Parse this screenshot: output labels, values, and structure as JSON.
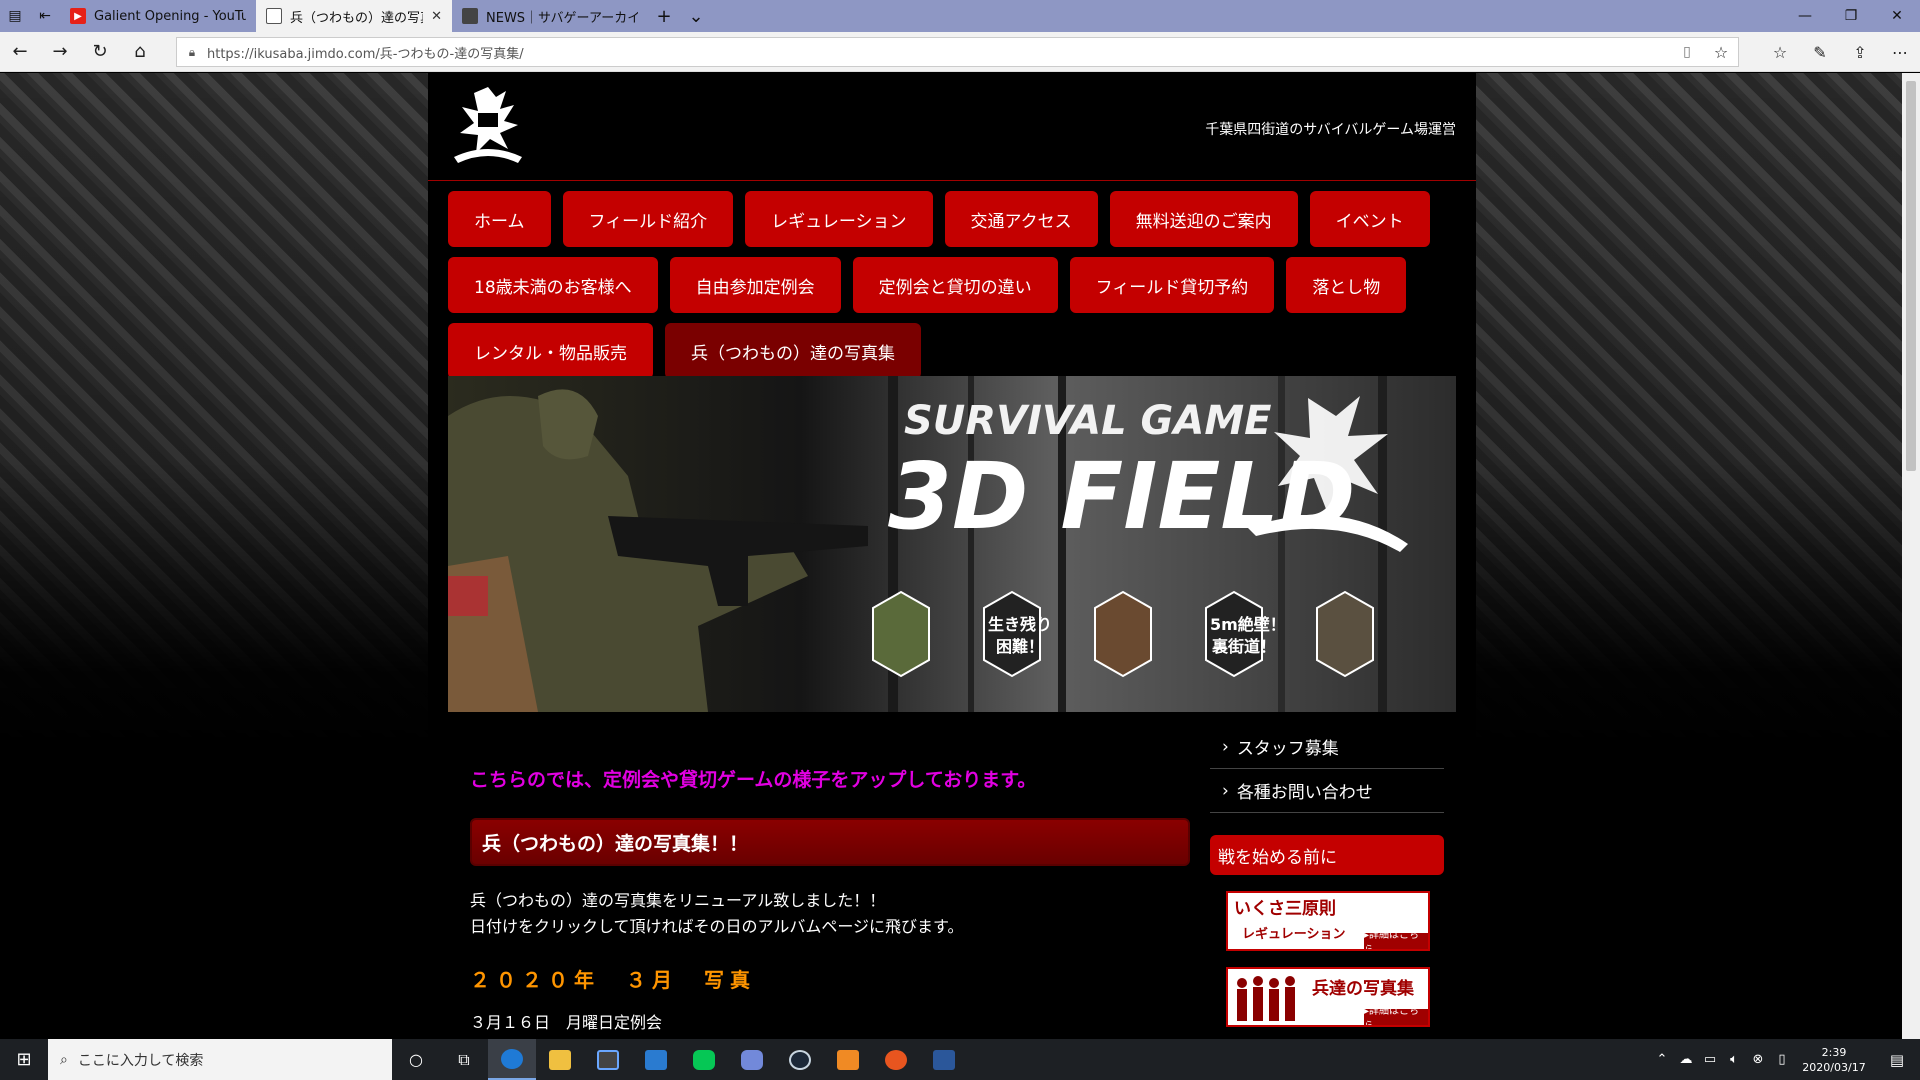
{
  "browser": {
    "tabs": [
      {
        "title": "Galient Opening - YouTube",
        "fav_color": "#e62117",
        "active": false
      },
      {
        "title": "兵（つわもの）達の写真集",
        "fav_color": "#555555",
        "active": true
      },
      {
        "title": "NEWS｜サバゲーアーカイブ",
        "fav_color": "#444444",
        "active": false
      }
    ],
    "url": "https://ikusaba.jimdo.com/兵-つわもの-達の写真集/"
  },
  "site": {
    "tagline": "千葉県四街道のサバイバルゲーム場運営",
    "menu_rows": [
      [
        "ホーム",
        "フィールド紹介",
        "レギュレーション",
        "交通アクセス",
        "無料送迎のご案内",
        "イベント"
      ],
      [
        "18歳未満のお客様へ",
        "自由参加定例会",
        "定例会と貸切の違い",
        "フィールド貸切予約",
        "落とし物"
      ],
      [
        "レンタル・物品販売",
        "兵（つわもの）達の写真集"
      ]
    ],
    "active_menu": "兵（つわもの）達の写真集",
    "banner": {
      "line1": "SURVIVAL GAME",
      "line2": "3D FIELD",
      "hex1": "生き残り\n困難！",
      "hex2": "5m絶壁！\n裏街道！"
    },
    "main": {
      "lead": "こちらのでは、定例会や貸切ゲームの様子をアップしております。",
      "heading": "兵（つわもの）達の写真集！！",
      "para1": "兵（つわもの）達の写真集をリニューアル致しました！！",
      "para2": "日付けをクリックして頂ければその日のアルバムページに飛びます。",
      "year": "２０２０年　３月　写真",
      "first_entry": "３月１６日　月曜日定例会"
    },
    "sidebar": {
      "links": [
        "スタッフ募集",
        "各種お問い合わせ"
      ],
      "heading": "戦を始める前に",
      "banner1": {
        "title": "いくさ三原則",
        "sub": "レギュレーション",
        "more": "▸詳細はこちら"
      },
      "banner2": {
        "title": "兵達の写真集",
        "more": "▸詳細はこちら"
      }
    }
  },
  "taskbar": {
    "search_placeholder": "ここに入力して検索",
    "time": "2:39",
    "date": "2020/03/17"
  }
}
